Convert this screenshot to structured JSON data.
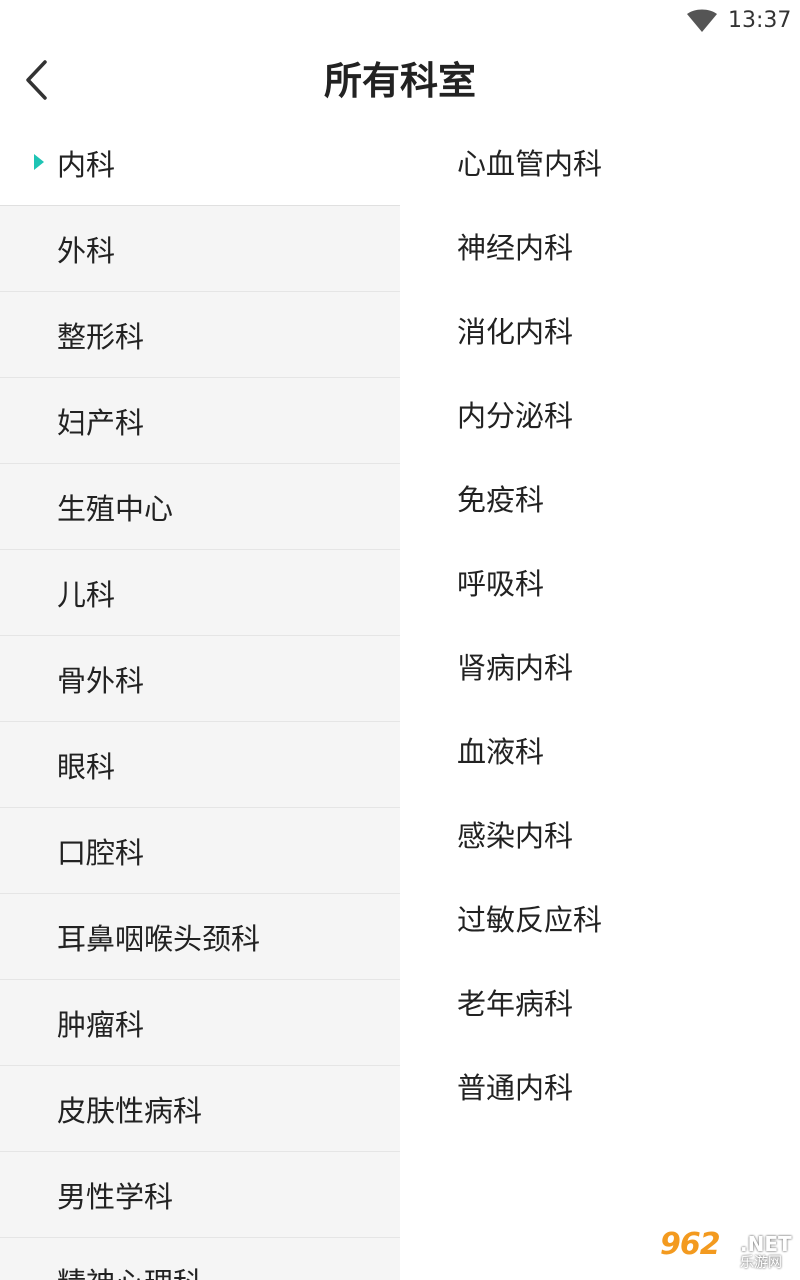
{
  "status_bar": {
    "time": "13:37",
    "icons": [
      "wifi-icon"
    ]
  },
  "header": {
    "title": "所有科室",
    "back_icon": "chevron-left-icon"
  },
  "colors": {
    "accent": "#1ec4b4",
    "left_panel_bg": "#f5f5f5",
    "divider": "#e5e5e5"
  },
  "left_menu": {
    "selected_index": 0,
    "items": [
      {
        "label": "内科"
      },
      {
        "label": "外科"
      },
      {
        "label": "整形科"
      },
      {
        "label": "妇产科"
      },
      {
        "label": "生殖中心"
      },
      {
        "label": "儿科"
      },
      {
        "label": "骨外科"
      },
      {
        "label": "眼科"
      },
      {
        "label": "口腔科"
      },
      {
        "label": "耳鼻咽喉头颈科"
      },
      {
        "label": "肿瘤科"
      },
      {
        "label": "皮肤性病科"
      },
      {
        "label": "男性学科"
      },
      {
        "label": "精神心理科"
      }
    ]
  },
  "sub_departments": {
    "items": [
      {
        "label": "心血管内科"
      },
      {
        "label": "神经内科"
      },
      {
        "label": "消化内科"
      },
      {
        "label": "内分泌科"
      },
      {
        "label": "免疫科"
      },
      {
        "label": "呼吸科"
      },
      {
        "label": "肾病内科"
      },
      {
        "label": "血液科"
      },
      {
        "label": "感染内科"
      },
      {
        "label": "过敏反应科"
      },
      {
        "label": "老年病科"
      },
      {
        "label": "普通内科"
      }
    ]
  },
  "watermark": {
    "brand": "962",
    "suffix": ".NET",
    "sub": "乐游网"
  }
}
